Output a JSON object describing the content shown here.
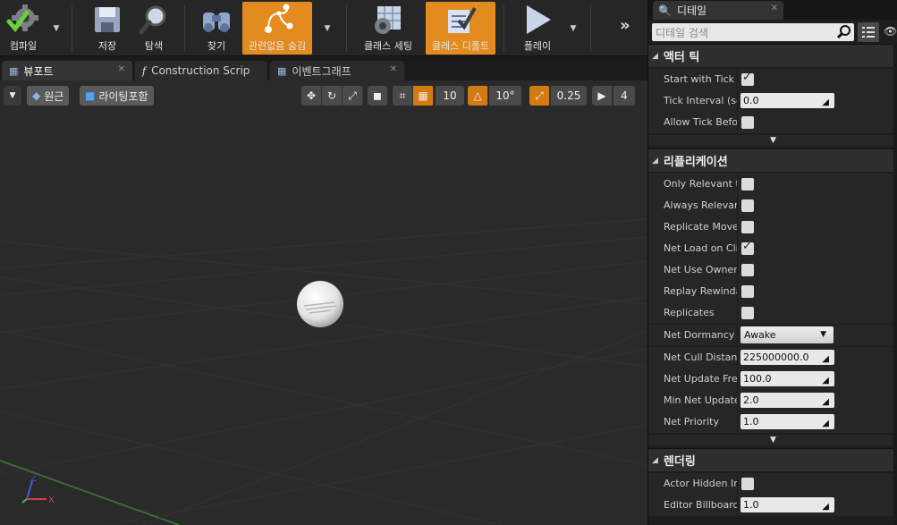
{
  "toolbar": {
    "compile": "컴파일",
    "save": "저장",
    "browse": "탐색",
    "find": "찾기",
    "hide_unrelated": "관련없음 숨김",
    "class_settings": "클래스 세팅",
    "class_defaults": "클래스 디폴트",
    "play": "플레이"
  },
  "tabs": [
    {
      "label": "뷰포트"
    },
    {
      "label": "Construction Scrip"
    },
    {
      "label": "이벤트그래프"
    }
  ],
  "viewport": {
    "perspective": "원근",
    "lighting": "라이팅포함",
    "grid_snap": "10",
    "rot_snap": "10°",
    "scale_snap": "0.25",
    "cam_speed": "4"
  },
  "details": {
    "tab_label": "디테일",
    "search_placeholder": "디테일 검색",
    "categories": {
      "actor_tick": "액터 틱",
      "replication": "리플리케이션",
      "rendering": "렌더링"
    },
    "tick": [
      {
        "name": "Start with Tick E",
        "checked": true
      },
      {
        "name": "Tick Interval (se",
        "value": "0.0"
      },
      {
        "name": "Allow Tick Befor",
        "checked": false
      }
    ],
    "replication": [
      {
        "name": "Only Relevant to",
        "checked": false
      },
      {
        "name": "Always Relevant",
        "checked": false
      },
      {
        "name": "Replicate Mover",
        "checked": false
      },
      {
        "name": "Net Load on Clie",
        "checked": true
      },
      {
        "name": "Net Use Owner R",
        "checked": false
      },
      {
        "name": "Replay Rewindab",
        "checked": false
      },
      {
        "name": "Replicates",
        "checked": false
      },
      {
        "name": "Net Dormancy",
        "combo": "Awake"
      },
      {
        "name": "Net Cull Distanc",
        "value": "225000000.0"
      },
      {
        "name": "Net Update Freq",
        "value": "100.0"
      },
      {
        "name": "Min Net Update",
        "value": "2.0"
      },
      {
        "name": "Net Priority",
        "value": "1.0"
      }
    ],
    "rendering": [
      {
        "name": "Actor Hidden In",
        "checked": false
      },
      {
        "name": "Editor Billboard S",
        "value": "1.0"
      }
    ]
  },
  "colors": {
    "accent": "#e38b1e",
    "panel": "#262626",
    "viewport_bg": "#2a2a2a"
  }
}
